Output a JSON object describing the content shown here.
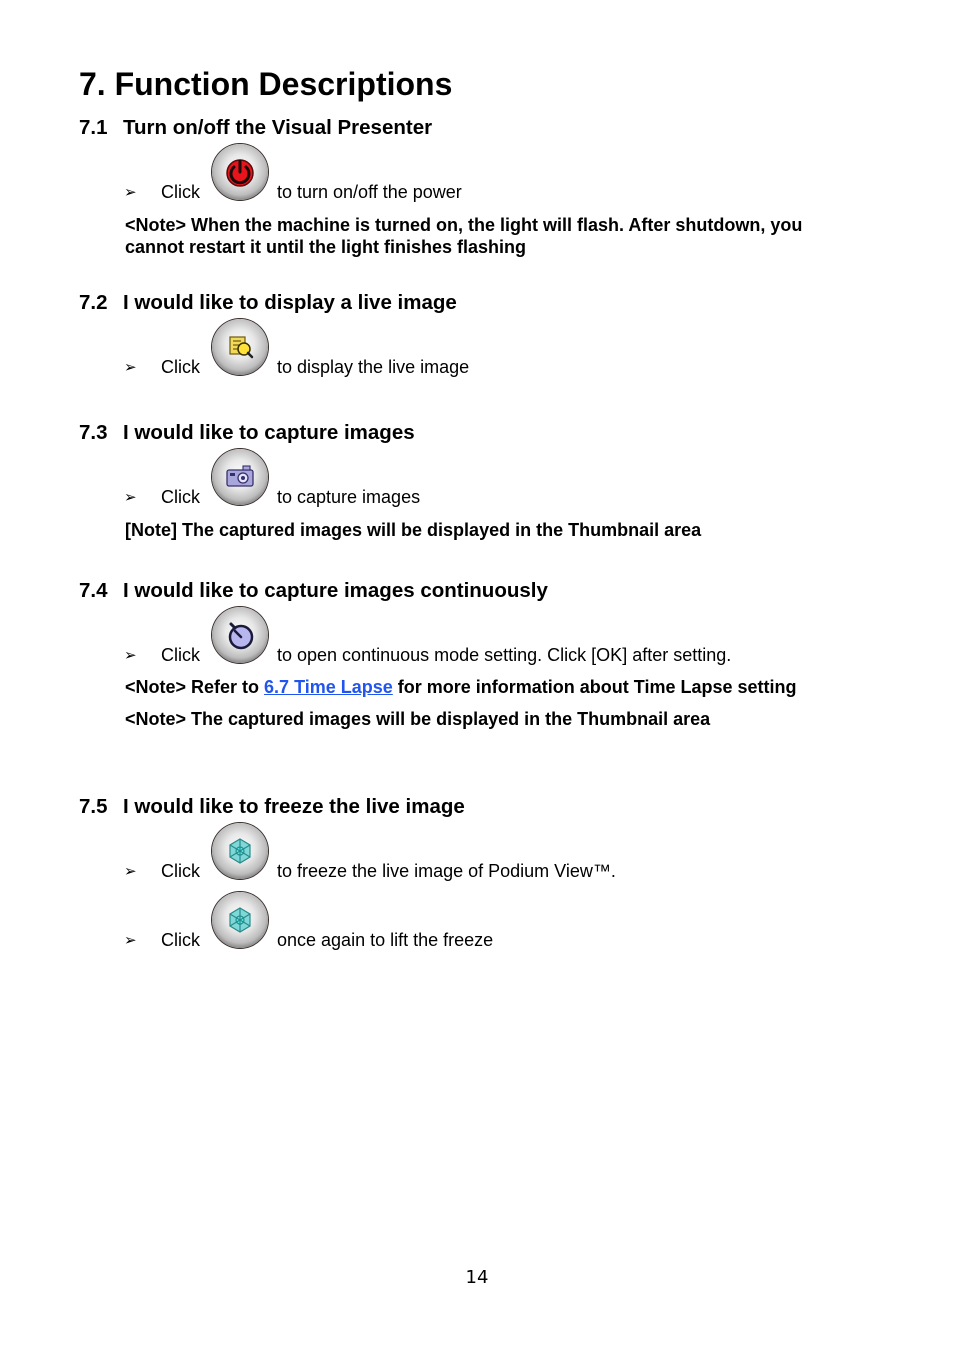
{
  "page_title": "7. Function Descriptions",
  "sections": [
    {
      "number": "7.1",
      "title": "Turn on/off the Visual Presenter",
      "items": [
        {
          "bullet": "➢",
          "click_label": "Click",
          "icon": "power-icon",
          "description": "to turn on/off the power"
        }
      ],
      "notes": [
        "<Note> When the machine is turned on, the light will flash. After shutdown, you",
        "cannot restart it until the light finishes flashing"
      ]
    },
    {
      "number": "7.2",
      "title": "I would like to display a live image",
      "items": [
        {
          "bullet": "➢",
          "click_label": "Click",
          "icon": "live-image-icon",
          "description": "to display the live image"
        }
      ]
    },
    {
      "number": "7.3",
      "title": "I would like to capture images",
      "items": [
        {
          "bullet": "➢",
          "click_label": "Click",
          "icon": "camera-icon",
          "description": "to capture images"
        }
      ],
      "notes": [
        "[Note] The captured images will be displayed in the Thumbnail area"
      ]
    },
    {
      "number": "7.4",
      "title": "I would like to capture images continuously",
      "items": [
        {
          "bullet": "➢",
          "click_label": "Click",
          "icon": "timer-icon",
          "description": "to open continuous mode setting. Click [OK] after setting."
        }
      ],
      "notes_link": {
        "prefix": "<Note> Refer to ",
        "link_text": "6.7 Time Lapse",
        "suffix": " for more information about Time Lapse setting"
      },
      "notes": [
        "<Note> The captured images will be displayed in the Thumbnail area"
      ]
    },
    {
      "number": "7.5",
      "title": "I would like to freeze the live image",
      "items": [
        {
          "bullet": "➢",
          "click_label": "Click",
          "icon": "freeze-icon",
          "description": "to freeze the live image of Podium View™."
        },
        {
          "bullet": "➢",
          "click_label": "Click",
          "icon": "freeze-icon",
          "description": "once again to lift the freeze"
        }
      ]
    }
  ],
  "colors": {
    "link": "#2255ee",
    "power_red": "#e8141b"
  },
  "page_number": "14"
}
